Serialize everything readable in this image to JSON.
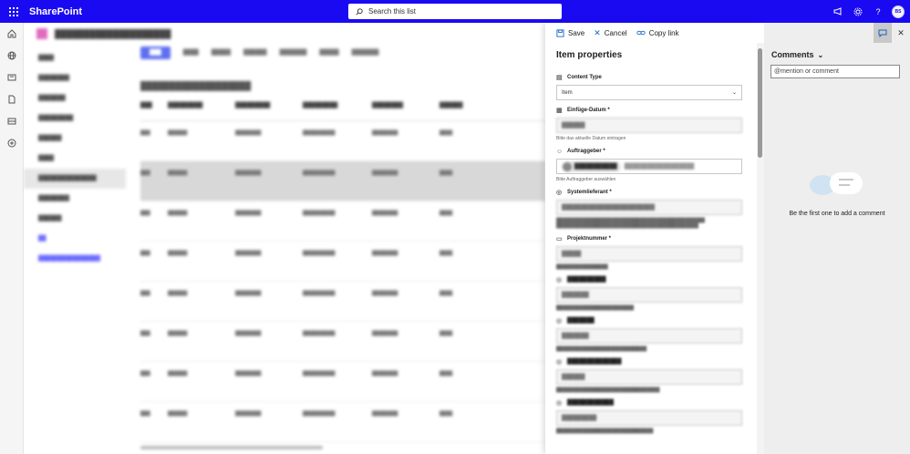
{
  "app": {
    "brand": "SharePoint",
    "search_placeholder": "Search this list",
    "user_initials": "BS"
  },
  "panel": {
    "commands": {
      "save": "Save",
      "cancel": "Cancel",
      "copy_link": "Copy link"
    },
    "title": "Item properties",
    "fields": {
      "content_type": {
        "label": "Content Type",
        "value": "Item"
      },
      "einfuege_datum": {
        "label": "Einfüge-Datum *",
        "hint": "Bitte das aktuelle Datum eintragen"
      },
      "auftraggeber": {
        "label": "Auftraggeber *",
        "hint": "Bitte Auftraggeber auswählen"
      },
      "systemlieferant": {
        "label": "Systemlieferant *"
      },
      "projektnummer": {
        "label": "Projektnummer *"
      }
    }
  },
  "comments": {
    "title": "Comments",
    "input_placeholder": "@mention or comment",
    "empty_text": "Be the first one to add a comment"
  },
  "colors": {
    "topbar": "#1a0af2",
    "accent": "#1a63c7"
  }
}
